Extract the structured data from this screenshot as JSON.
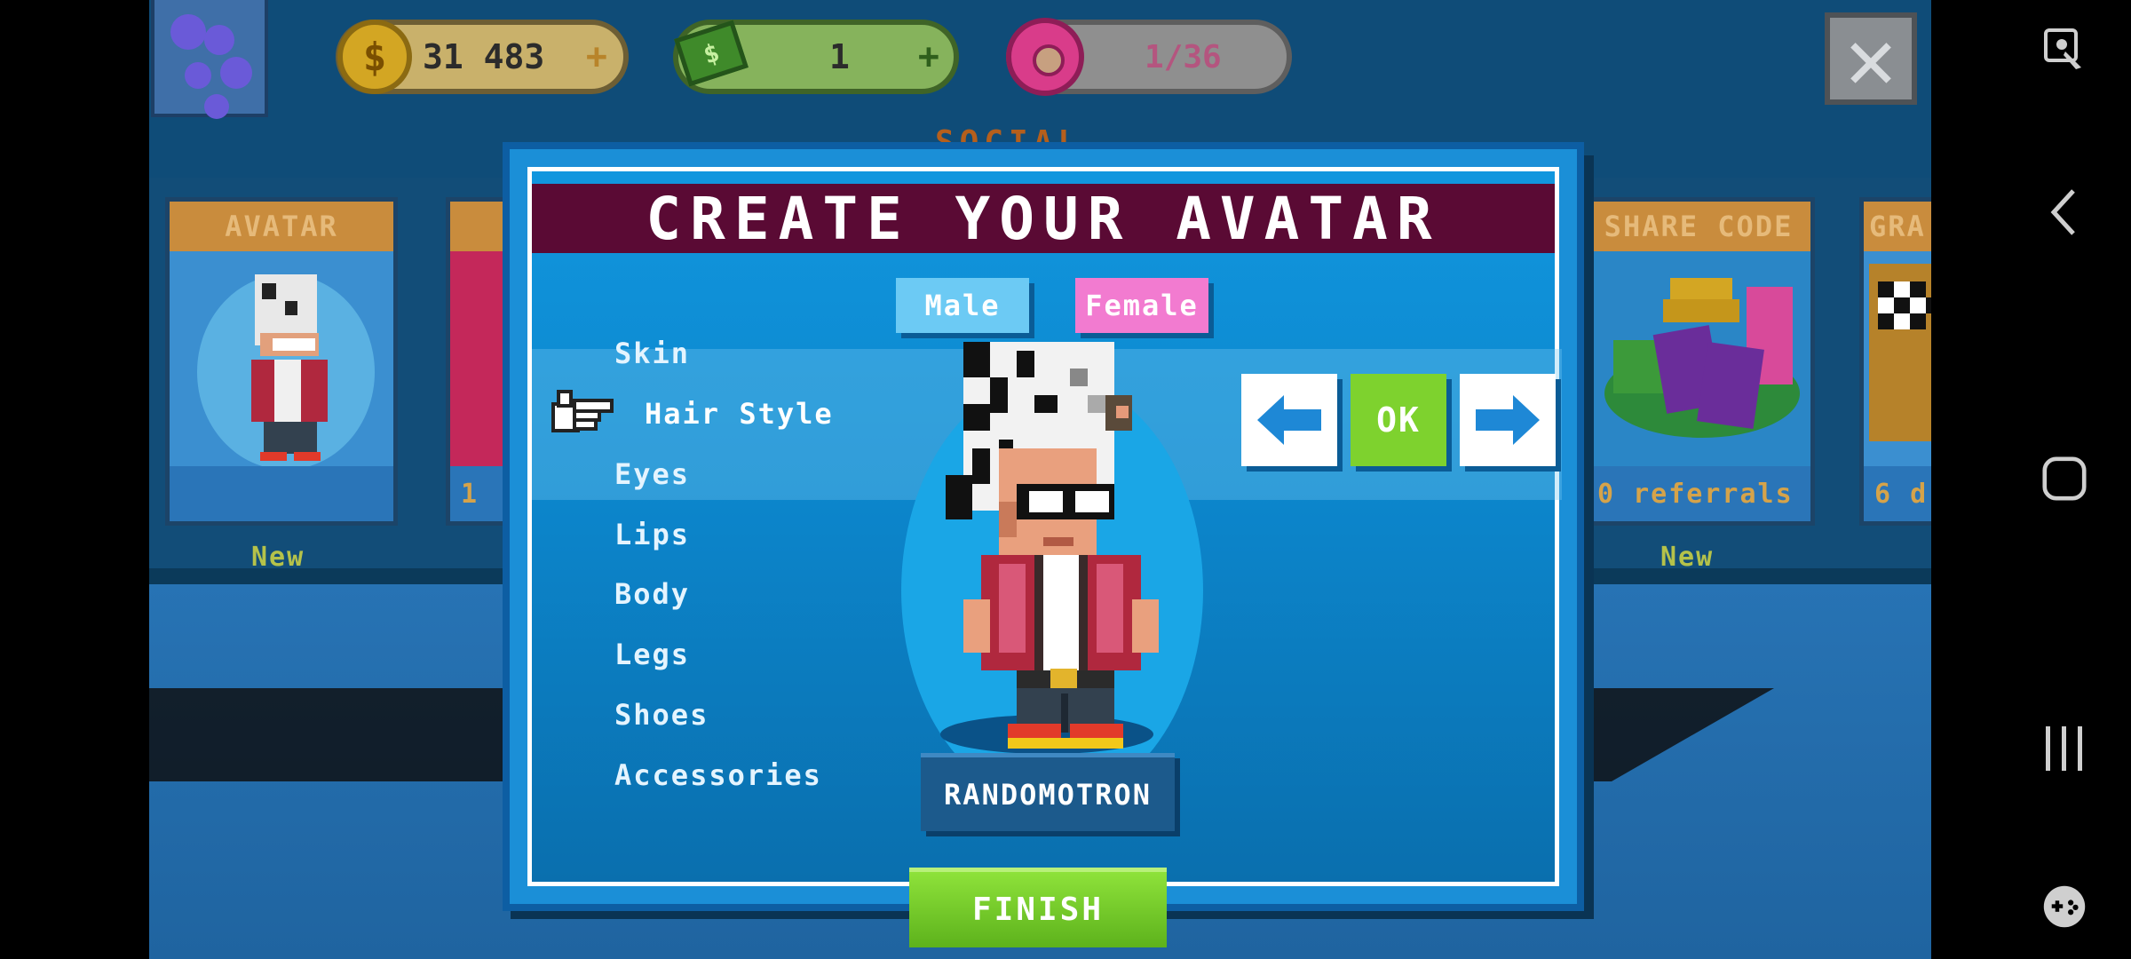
{
  "resources": {
    "coins": {
      "icon": "coin-icon",
      "value": "31 483",
      "plus": "+"
    },
    "cash": {
      "icon": "cash-icon",
      "value": "1",
      "plus": "+"
    },
    "donuts": {
      "icon": "donut-icon",
      "value": "1/36"
    }
  },
  "background": {
    "section_label": "SOCIAL",
    "cards": [
      {
        "title": "AVATAR",
        "footer": "",
        "badge": "New"
      },
      {
        "title": "",
        "footer": "1",
        "badge": ""
      },
      {
        "title": "SHARE CODE",
        "footer": "0 referrals",
        "badge": "New"
      },
      {
        "title": "GRA",
        "footer": "6 d",
        "badge": ""
      }
    ]
  },
  "dialog": {
    "title": "CREATE YOUR AVATAR",
    "gender": {
      "male": "Male",
      "female": "Female",
      "selected": "male"
    },
    "menu": [
      "Skin",
      "Hair Style",
      "Eyes",
      "Lips",
      "Body",
      "Legs",
      "Shoes",
      "Accessories"
    ],
    "active_menu_item": "Hair Style",
    "ok_label": "OK",
    "randomize_label": "RANDOMOTRON",
    "finish_label": "FINISH"
  },
  "colors": {
    "title_bar": "#5a0a34",
    "male": "#6ccaf4",
    "female": "#f27bd0",
    "ok": "#7ed22e",
    "finish": "#6cc624",
    "panel": "#1b8fd7"
  },
  "system_nav": [
    "screen-capture-icon",
    "back-icon",
    "home-icon",
    "recents-icon",
    "game-tools-icon"
  ]
}
